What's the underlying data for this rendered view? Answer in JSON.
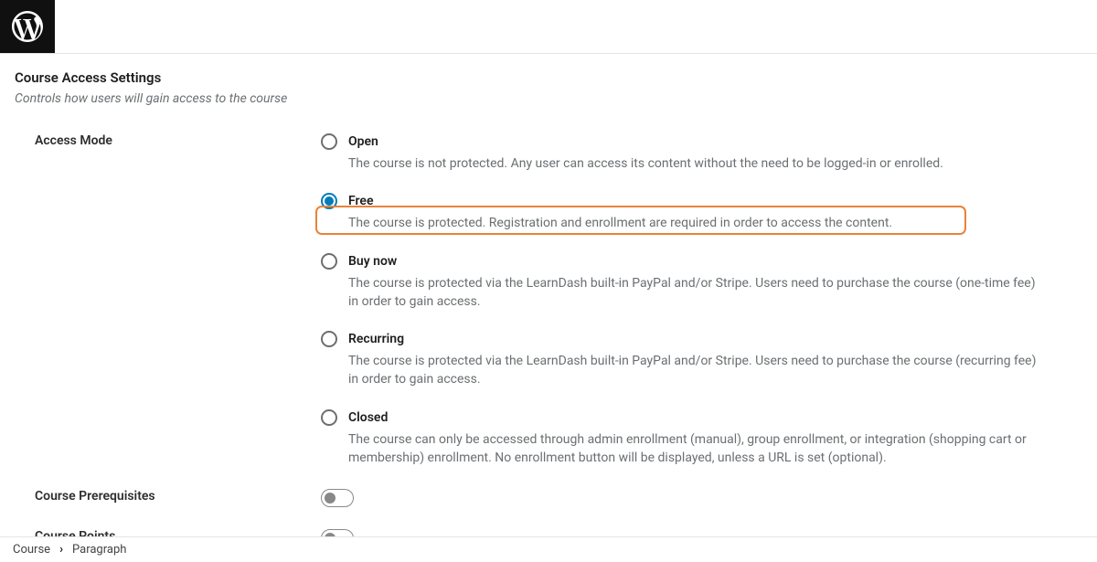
{
  "section": {
    "title": "Course Access Settings",
    "description": "Controls how users will gain access to the course"
  },
  "accessMode": {
    "label": "Access Mode",
    "selectedIndex": 1,
    "highlightIndex": 1,
    "options": [
      {
        "title": "Open",
        "desc": "The course is not protected. Any user can access its content without the need to be logged-in or enrolled."
      },
      {
        "title": "Free",
        "desc": "The course is protected. Registration and enrollment are required in order to access the content."
      },
      {
        "title": "Buy now",
        "desc": "The course is protected via the LearnDash built-in PayPal and/or Stripe. Users need to purchase the course (one-time fee) in order to gain access."
      },
      {
        "title": "Recurring",
        "desc": "The course is protected via the LearnDash built-in PayPal and/or Stripe. Users need to purchase the course (recurring fee) in order to gain access."
      },
      {
        "title": "Closed",
        "desc": "The course can only be accessed through admin enrollment (manual), group enrollment, or integration (shopping cart or membership) enrollment. No enrollment button will be displayed, unless a URL is set (optional)."
      }
    ]
  },
  "prerequisites": {
    "label": "Course Prerequisites",
    "enabled": false
  },
  "points": {
    "label": "Course Points",
    "enabled": false
  },
  "breadcrumb": {
    "item0": "Course",
    "item1": "Paragraph"
  }
}
